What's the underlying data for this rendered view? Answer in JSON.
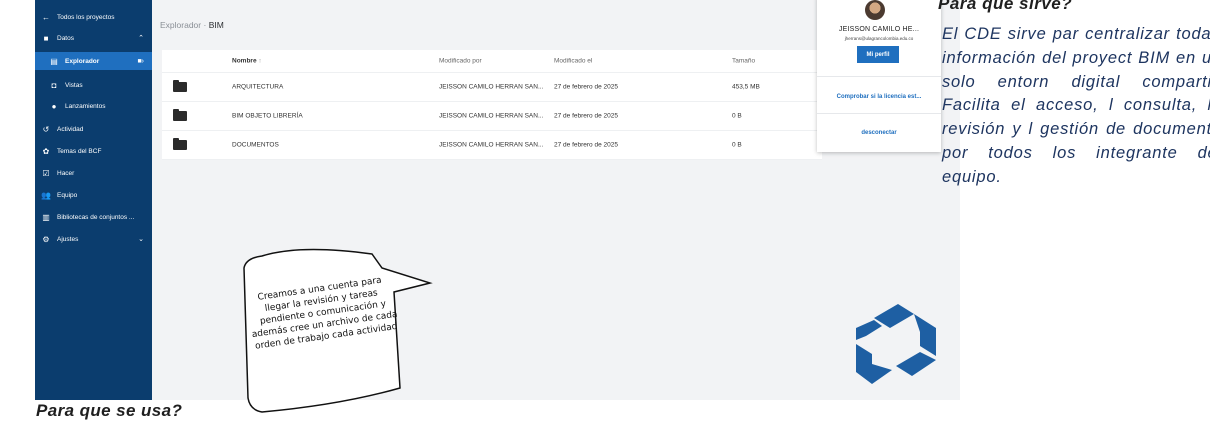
{
  "sidebar": {
    "items": [
      {
        "icon": "arrow-left-icon",
        "label": "Todos los proyectos"
      },
      {
        "icon": "folder-icon",
        "label": "Datos"
      },
      {
        "icon": "explorer-icon",
        "label": "Explorador"
      },
      {
        "icon": "camera-icon",
        "label": "Vistas"
      },
      {
        "icon": "dot-icon",
        "label": "Lanzamientos"
      },
      {
        "icon": "history-icon",
        "label": "Actividad"
      },
      {
        "icon": "bcf-icon",
        "label": "Temas del BCF"
      },
      {
        "icon": "checkbox-icon",
        "label": "Hacer"
      },
      {
        "icon": "team-icon",
        "label": "Equipo"
      },
      {
        "icon": "library-icon",
        "label": "Bibliotecas de conjuntos ..."
      },
      {
        "icon": "gear-icon",
        "label": "Ajustes"
      }
    ]
  },
  "breadcrumb": {
    "root": "Explorador",
    "separator": "·",
    "current": "BIM"
  },
  "table": {
    "headers": {
      "name": "Nombre",
      "sort": "↑",
      "modified_by": "Modificado por",
      "modified_on": "Modificado el",
      "size": "Tamaño"
    },
    "rows": [
      {
        "name": "ARQUITECTURA",
        "modified_by": "JEISSON CAMILO HERRAN SAN...",
        "modified_on": "27 de febrero de 2025",
        "size": "453,5 MB"
      },
      {
        "name": "BIM OBJETO LIBRERÍA",
        "modified_by": "JEISSON CAMILO HERRAN SAN...",
        "modified_on": "27 de febrero de 2025",
        "size": "0 B"
      },
      {
        "name": "DOCUMENTOS",
        "modified_by": "JEISSON CAMILO HERRAN SAN...",
        "modified_on": "27 de febrero de 2025",
        "size": "0 B"
      }
    ]
  },
  "profile": {
    "name": "JEISSON CAMILO HE...",
    "email": "jherrans@ulagrancolombia.edu.co",
    "button": "Mi perfil",
    "license_link": "Comprobar si la licencia est...",
    "logout": "desconectar"
  },
  "bubble": {
    "text": "Creamos a una cuenta para llegar la revisión y tareas pendiente o comunicación y además cree un archivo de cada orden de trabajo cada actividad"
  },
  "right": {
    "heading": "Para que sirve?",
    "paragraph": "El CDE sirve par centralizar toda l información del proyect BIM en un solo entorn digital compartid Facilita el acceso, l consulta, la revisión y l gestión de documenta por todos los integrante del equipo."
  },
  "bottom": {
    "heading": "Para que se usa?"
  },
  "colors": {
    "sidebar": "#0b3d6e",
    "accent": "#1f6fbf",
    "text_blue": "#1e3560"
  }
}
